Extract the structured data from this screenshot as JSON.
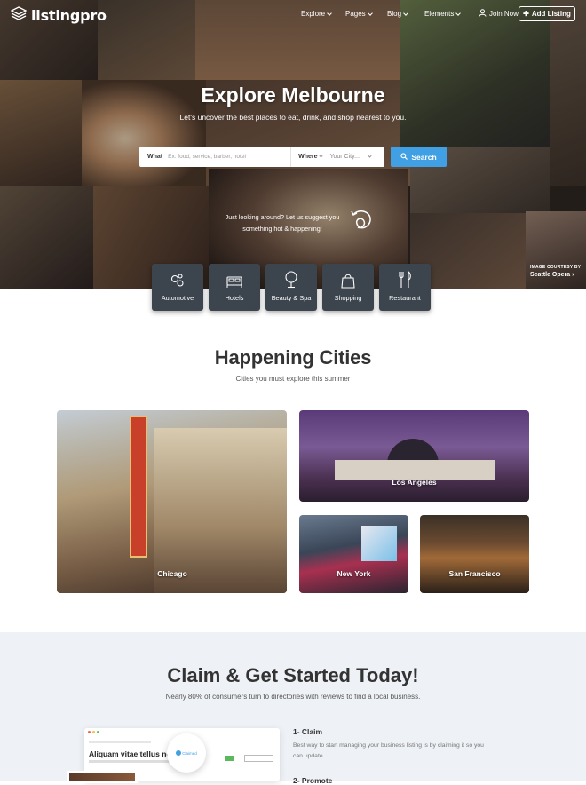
{
  "brand": {
    "name": "listingpro"
  },
  "nav": {
    "items": [
      {
        "label": "Explore"
      },
      {
        "label": "Pages"
      },
      {
        "label": "Blog"
      },
      {
        "label": "Elements"
      }
    ],
    "join_label": "Join Now",
    "add_label": "Add Listing"
  },
  "hero": {
    "title": "Explore Melbourne",
    "subtitle": "Let's uncover the best places to eat, drink, and shop nearest to you.",
    "what_label": "What",
    "what_placeholder": "Ex: food, service, barber, hotel",
    "where_label": "Where",
    "where_placeholder": "Your City...",
    "search_label": "Search",
    "suggest_line1": "Just looking around? Let us suggest you",
    "suggest_line2": "something hot & happening!",
    "credit_line1": "IMAGE COURTESY BY",
    "credit_line2": "Seattle Opera"
  },
  "categories": [
    {
      "label": "Automotive",
      "icon": "gears-icon"
    },
    {
      "label": "Hotels",
      "icon": "bed-icon"
    },
    {
      "label": "Beauty & Spa",
      "icon": "mirror-icon"
    },
    {
      "label": "Shopping",
      "icon": "shopping-bag-icon"
    },
    {
      "label": "Restaurant",
      "icon": "fork-knife-icon"
    }
  ],
  "cities": {
    "title": "Happening Cities",
    "subtitle": "Cities you must explore this summer",
    "items": [
      {
        "name": "Chicago"
      },
      {
        "name": "Los Angeles"
      },
      {
        "name": "New York"
      },
      {
        "name": "San Francisco"
      }
    ]
  },
  "claim": {
    "title": "Claim & Get Started Today!",
    "subtitle": "Nearly 80% of consumers turn to directories with reviews to find a local business.",
    "mock_title": "Aliquam vitae tellus non",
    "mock_badge": "Claimed",
    "steps": [
      {
        "title": "1- Claim",
        "desc": "Best way to start managing your business listing is by claiming it so you can update."
      },
      {
        "title": "2- Promote"
      }
    ]
  },
  "colors": {
    "accent": "#41a0e4",
    "card_bg": "#3c444e",
    "claim_bg": "#eef1f5"
  }
}
